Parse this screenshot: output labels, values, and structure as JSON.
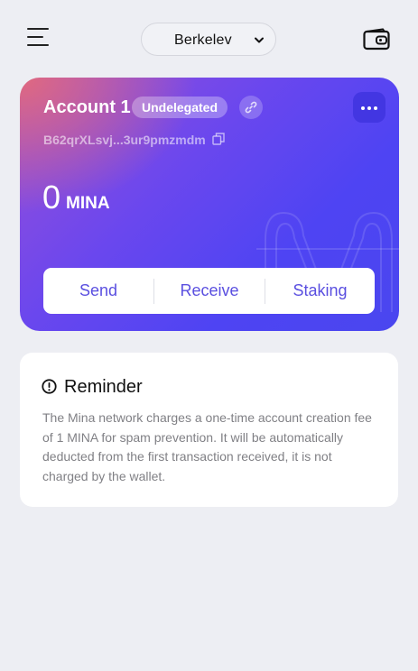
{
  "header": {
    "network": "Berkelev",
    "menu_icon": "hamburger-menu-icon",
    "wallet_icon": "wallet-icon"
  },
  "account": {
    "name": "Account 1",
    "status_badge": "Undelegated",
    "address": "B62qrXLsvj...3ur9pmzmdm",
    "balance": {
      "amount": "0",
      "unit": "MINA"
    },
    "actions": {
      "send": "Send",
      "receive": "Receive",
      "staking": "Staking"
    }
  },
  "reminder": {
    "title": "Reminder",
    "text": "The Mina network charges a one-time account creation fee of 1 MINA for spam prevention. It will be automatically deducted from the first transaction received, it is not charged by the wallet."
  },
  "colors": {
    "background": "#edeef3",
    "accent": "#5a4fe0",
    "card_gradient_start": "#e0697f",
    "card_gradient_end": "#4a46ef"
  }
}
